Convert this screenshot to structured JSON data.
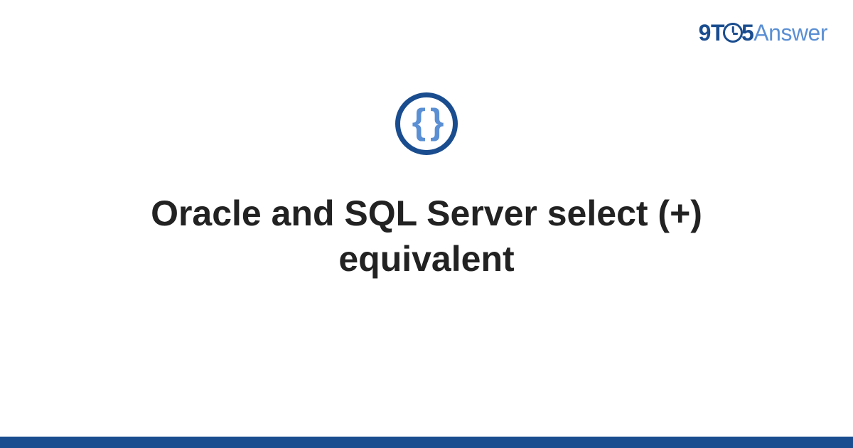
{
  "logo": {
    "part1": "9T",
    "part2": "5",
    "part3": "Answer"
  },
  "icon": {
    "glyph": "{ }"
  },
  "title": "Oracle and SQL Server select (+) equivalent"
}
